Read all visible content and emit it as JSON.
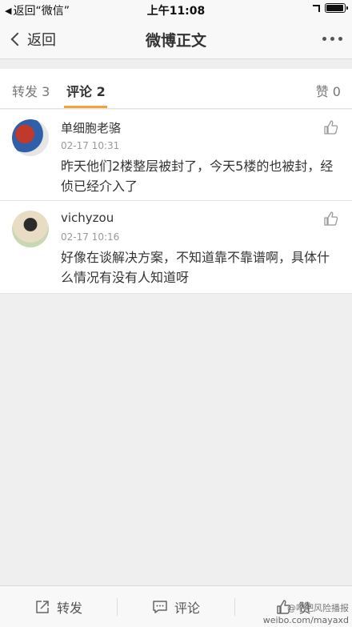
{
  "status_bar": {
    "back_label": "返回“微信”",
    "time": "上午11:08",
    "battery_level": 0.95
  },
  "nav": {
    "back_label": "返回",
    "title": "微博正文"
  },
  "tabs": {
    "repost": "转发 3",
    "comment": "评论 2",
    "like": "赞 0"
  },
  "comments": [
    {
      "username": "单细胞老骆",
      "timestamp": "02-17 10:31",
      "text": "昨天他们2楼整层被封了，今天5楼的也被封，经侦已经介入了"
    },
    {
      "username": "vichyzou",
      "timestamp": "02-17 10:16",
      "text": "好像在谈解决方案，不知道靠不靠谱啊，具体什么情况有没有人知道呀"
    }
  ],
  "bottom_bar": {
    "repost_label": "转发",
    "comment_label": "评论",
    "like_label": "赞"
  },
  "watermark": {
    "top": "@吧吧风险播报",
    "bottom": "weibo.com/mayaxd"
  },
  "icons": {
    "share": "share-icon",
    "comment": "comment-icon",
    "like": "thumbs-up-icon"
  }
}
